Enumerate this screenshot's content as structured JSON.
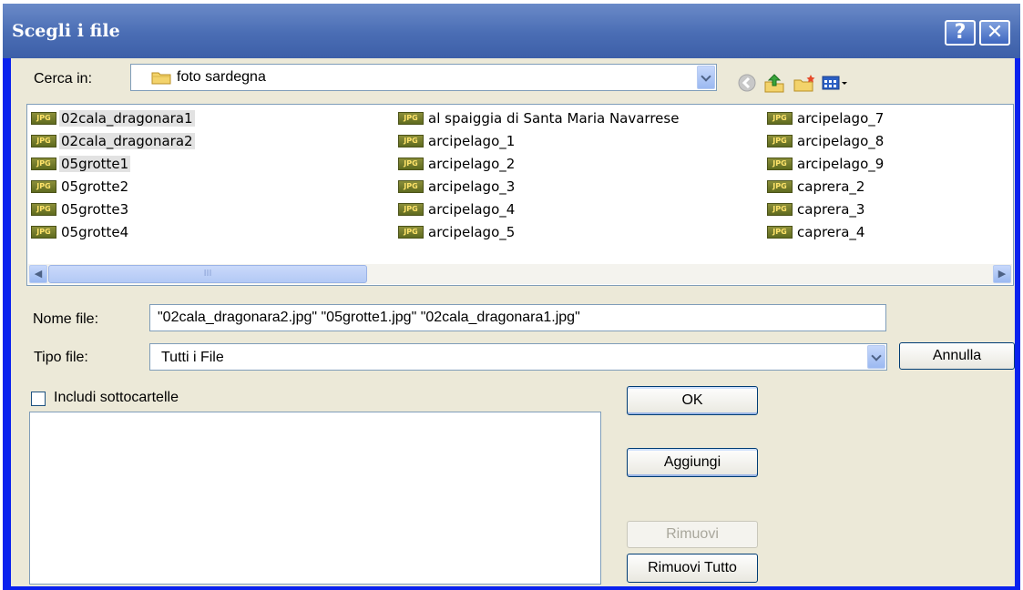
{
  "window": {
    "title": "Scegli i file"
  },
  "titlebar": {
    "help_glyph": "?",
    "close_glyph": "✕"
  },
  "toolbar": {
    "look_in_label": "Cerca in:",
    "look_in_value": "foto sardegna",
    "icons": [
      "folder-icon",
      "back-icon",
      "up-folder-icon",
      "new-folder-icon",
      "view-menu-icon"
    ]
  },
  "files": {
    "col1": [
      "02cala_dragonara1",
      "02cala_dragonara2",
      "05grotte1",
      "05grotte2",
      "05grotte3",
      "05grotte4"
    ],
    "col2": [
      "al spaiggia di Santa Maria Navarrese",
      "arcipelago_1",
      "arcipelago_2",
      "arcipelago_3",
      "arcipelago_4",
      "arcipelago_5"
    ],
    "col3": [
      "arcipelago_7",
      "arcipelago_8",
      "arcipelago_9",
      "caprera_2",
      "caprera_3",
      "caprera_4"
    ],
    "selected": [
      "02cala_dragonara1",
      "02cala_dragonara2",
      "05grotte1"
    ],
    "icon_text": "JPG"
  },
  "scrollbar": {
    "thumb_grip": "III"
  },
  "filename": {
    "label": "Nome file:",
    "value": "\"02cala_dragonara2.jpg\" \"05grotte1.jpg\" \"02cala_dragonara1.jpg\""
  },
  "filetype": {
    "label": "Tipo file:",
    "value": "Tutti i File"
  },
  "buttons": {
    "cancel": "Annulla",
    "ok": "OK",
    "add": "Aggiungi",
    "remove": "Rimuovi",
    "remove_all": "Rimuovi Tutto"
  },
  "include_subfolders": {
    "label": "Includi sottocartelle",
    "checked": false
  }
}
